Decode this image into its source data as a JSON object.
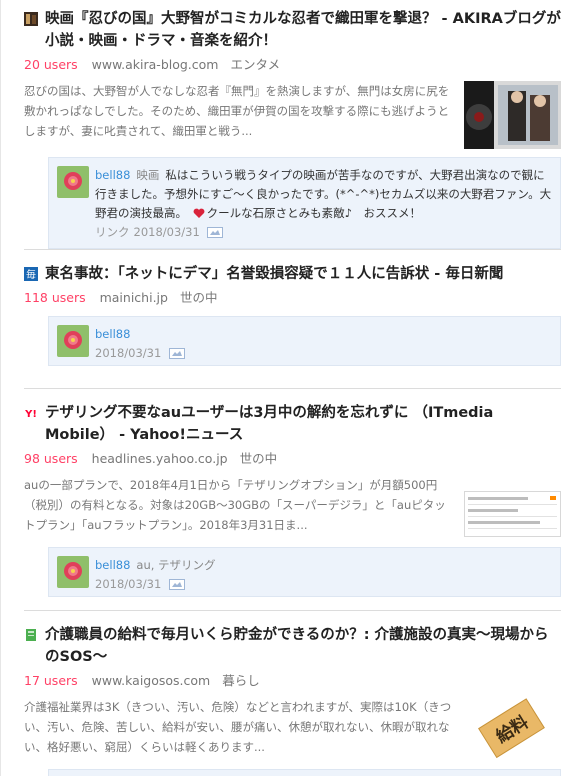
{
  "entries": [
    {
      "favicon": "akira-blog-favicon",
      "title": "映画『忍びの国』大野智がコミカルな忍者で織田軍を撃退？ - AKIRAブログが小説・映画・ドラマ・音楽を紹介！",
      "users": "20 users",
      "domain": "www.akira-blog.com",
      "category": "エンタメ",
      "summary": "忍びの国は、大野智が人でなしな忍者『無門』を熱演しますが、無門は女房に尻を敷かれっぱなしでした。そのため、織田軍が伊賀の国を攻撃する際にも逃げようとしますが、妻に叱責されて、織田軍と戦う...",
      "comment": {
        "user": "bell88",
        "tags": "映画",
        "text": "私はこういう戦うタイプの映画が苦手なのですが、大野君出演なので観に行きました。予想外にすご〜く良かったです。(*^-^*)セカムズ以来の大野君ファン。大野君の演技最高。",
        "text2": "クールな石原さとみも素敵♪　おススメ！",
        "link_label": "リンク",
        "date": "2018/03/31"
      }
    },
    {
      "favicon": "mainichi-favicon",
      "favicon_text": "毎",
      "title": "東名事故：「ネットにデマ」名誉毀損容疑で１１人に告訴状 - 毎日新聞",
      "users": "118 users",
      "domain": "mainichi.jp",
      "category": "世の中",
      "comment": {
        "user": "bell88",
        "date": "2018/03/31"
      }
    },
    {
      "favicon": "yahoo-favicon",
      "favicon_text": "Y!",
      "title": "テザリング不要なauユーザーは3月中の解約を忘れずに （ITmedia Mobile） - Yahoo!ニュース",
      "users": "98 users",
      "domain": "headlines.yahoo.co.jp",
      "category": "世の中",
      "summary": "auの一部プランで、2018年4月1日から「テザリングオプション」が月額500円（税別）の有料となる。対象は20GB〜30GBの「スーパーデジラ」と「auピタットプラン」「auフラットプラン」。2018年3月31日ま...",
      "comment": {
        "user": "bell88",
        "tags": "au, テザリング",
        "date": "2018/03/31"
      }
    },
    {
      "favicon": "kaigosos-favicon",
      "title": "介護職員の給料で毎月いくら貯金ができるのか？: 介護施設の真実〜現場からのSOS〜",
      "users": "17 users",
      "domain": "www.kaigosos.com",
      "category": "暮らし",
      "summary": "介護福祉業界は3K（きつい、汚い、危険）などと言われますが、実際は10K（きつい、汚い、危険、苦しい、給料が安い、腰が痛い、休憩が取れない、休暇が取れない、格好悪い、窮屈）くらいは軽くあります...",
      "thumb_text": "給料"
    }
  ],
  "colors": {
    "users": "#ff4166",
    "comment_bg": "#edf3fb",
    "username": "#3a8fd8"
  }
}
